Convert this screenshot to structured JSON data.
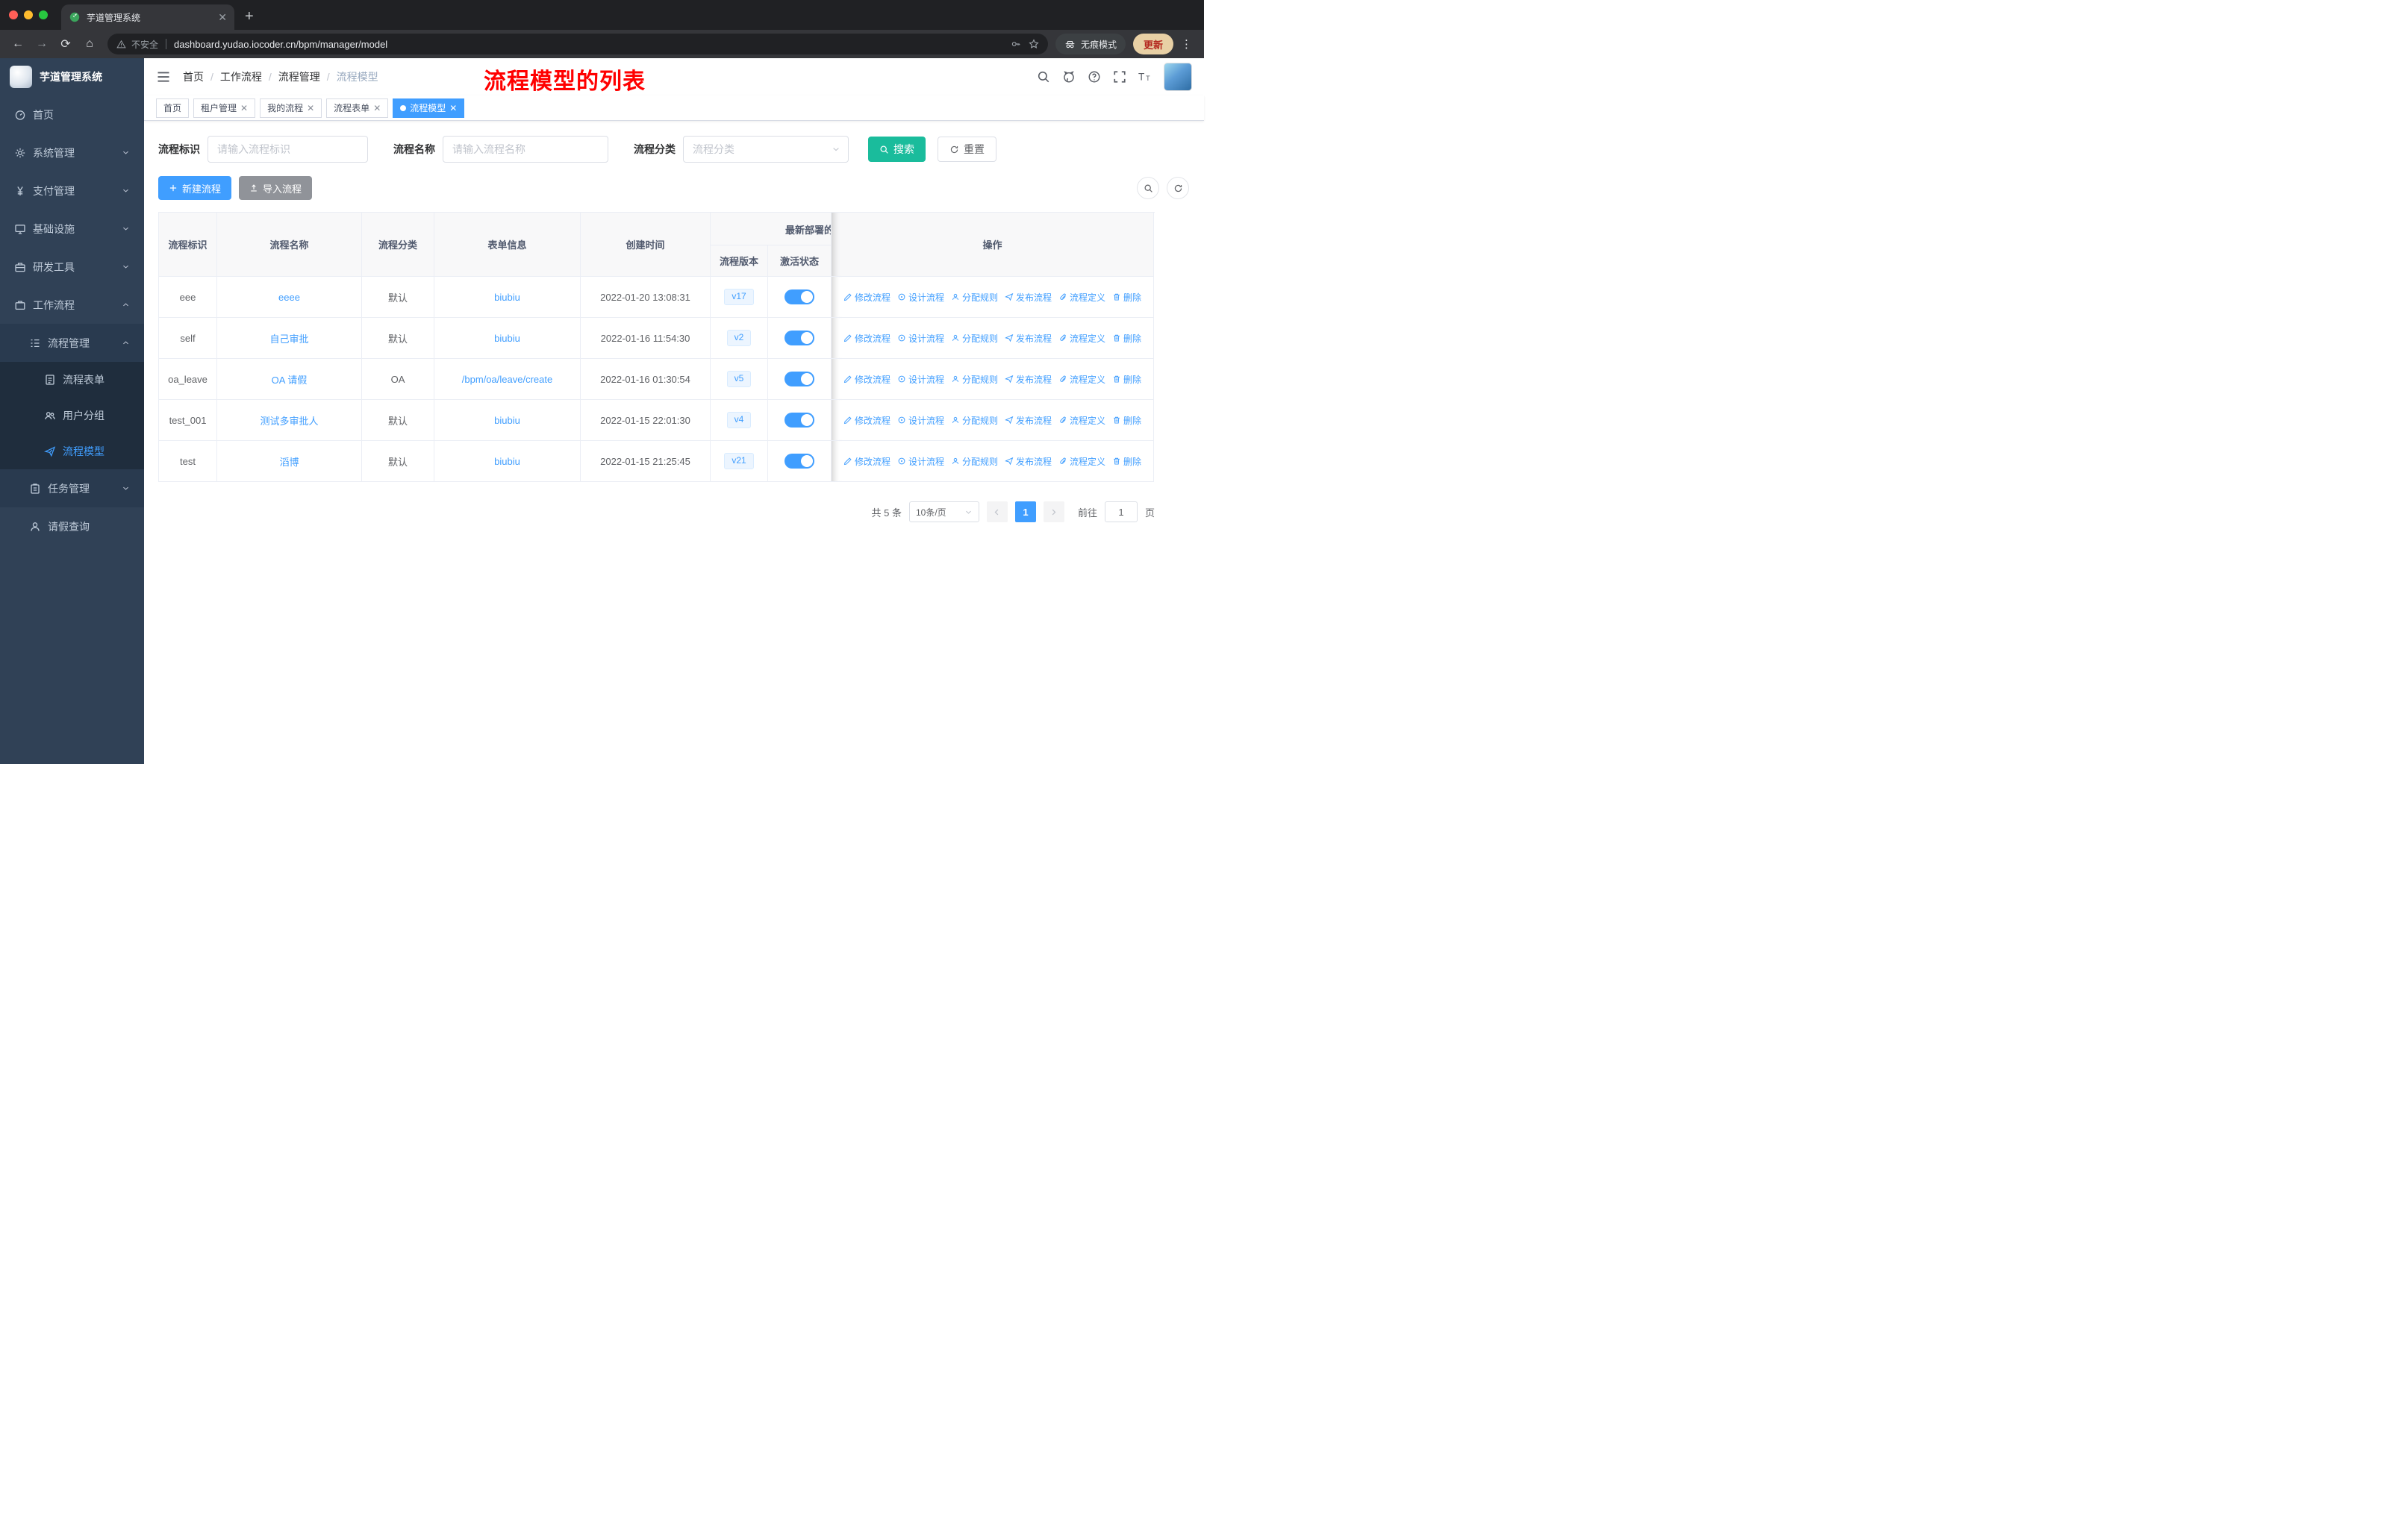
{
  "browser": {
    "tab_title": "芋道管理系统",
    "security_label": "不安全",
    "url": "dashboard.yudao.iocoder.cn/bpm/manager/model",
    "incognito_label": "无痕模式",
    "update_label": "更新"
  },
  "sidebar": {
    "logo_title": "芋道管理系统",
    "home": "首页",
    "system": "系统管理",
    "payment": "支付管理",
    "infra": "基础设施",
    "devtools": "研发工具",
    "workflow": "工作流程",
    "process_mgmt": "流程管理",
    "process_form": "流程表单",
    "user_group": "用户分组",
    "process_model": "流程模型",
    "task_mgmt": "任务管理",
    "leave_query": "请假查询"
  },
  "header": {
    "breadcrumb": [
      "首页",
      "工作流程",
      "流程管理",
      "流程模型"
    ],
    "annotation": "流程模型的列表"
  },
  "tags": [
    "首页",
    "租户管理",
    "我的流程",
    "流程表单",
    "流程模型"
  ],
  "filters": {
    "process_id_label": "流程标识",
    "process_id_placeholder": "请输入流程标识",
    "process_name_label": "流程名称",
    "process_name_placeholder": "请输入流程名称",
    "category_label": "流程分类",
    "category_placeholder": "流程分类",
    "search_label": "搜索",
    "reset_label": "重置"
  },
  "toolbar": {
    "create_label": "新建流程",
    "import_label": "导入流程"
  },
  "table": {
    "headers": {
      "process_id": "流程标识",
      "process_name": "流程名称",
      "category": "流程分类",
      "form_info": "表单信息",
      "create_time": "创建时间",
      "deploy_group": "最新部署的",
      "version": "流程版本",
      "active_status": "激活状态",
      "actions": "操作"
    },
    "action_labels": [
      "修改流程",
      "设计流程",
      "分配规则",
      "发布流程",
      "流程定义",
      "删除"
    ],
    "rows": [
      {
        "id": "eee",
        "name": "eeee",
        "category": "默认",
        "form": "biubiu",
        "time": "2022-01-20 13:08:31",
        "version": "v17",
        "active": true
      },
      {
        "id": "self",
        "name": "自己审批",
        "category": "默认",
        "form": "biubiu",
        "time": "2022-01-16 11:54:30",
        "version": "v2",
        "active": true
      },
      {
        "id": "oa_leave",
        "name": "OA 请假",
        "category": "OA",
        "form": "/bpm/oa/leave/create",
        "time": "2022-01-16 01:30:54",
        "version": "v5",
        "active": true
      },
      {
        "id": "test_001",
        "name": "测试多审批人",
        "category": "默认",
        "form": "biubiu",
        "time": "2022-01-15 22:01:30",
        "version": "v4",
        "active": true
      },
      {
        "id": "test",
        "name": "滔博",
        "category": "默认",
        "form": "biubiu",
        "time": "2022-01-15 21:25:45",
        "version": "v21",
        "active": true
      }
    ]
  },
  "pagination": {
    "total_label": "共 5 条",
    "page_size": "10条/页",
    "current_page": "1",
    "goto_label": "前往",
    "goto_value": "1",
    "page_unit": "页"
  },
  "colors": {
    "primary": "#409eff",
    "search_button": "#1abc9c",
    "annotation_red": "#ff0000",
    "sidebar_bg": "#304156"
  }
}
